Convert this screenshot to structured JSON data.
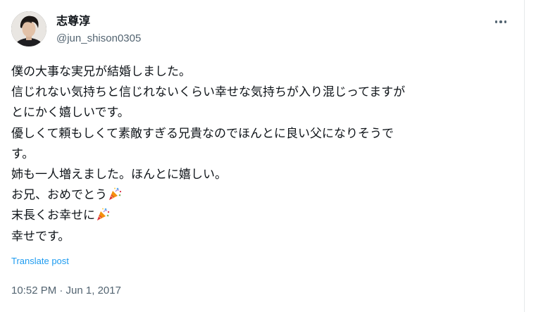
{
  "author": {
    "display_name": "志尊淳",
    "handle": "@jun_shison0305"
  },
  "tweet": {
    "lines": [
      "僕の大事な実兄が結婚しました。",
      "信じれない気持ちと信じれないくらい幸せな気持ちが入り混じってますが",
      "とにかく嬉しいです。",
      "優しくて頼もしくて素敵すぎる兄貴なのでほんとに良い父になりそうで",
      "す。",
      "姉も一人増えました。ほんとに嬉しい。",
      "お兄、おめでとう",
      "末長くお幸せに",
      "幸せです。"
    ],
    "emoji_icon": "party-popper-icon"
  },
  "actions": {
    "translate_label": "Translate post",
    "more_icon": "more-horizontal-icon"
  },
  "timestamp": "10:52 PM · Jun 1, 2017",
  "colors": {
    "text_primary": "#0f1419",
    "text_secondary": "#536471",
    "link": "#1d9bf0"
  }
}
